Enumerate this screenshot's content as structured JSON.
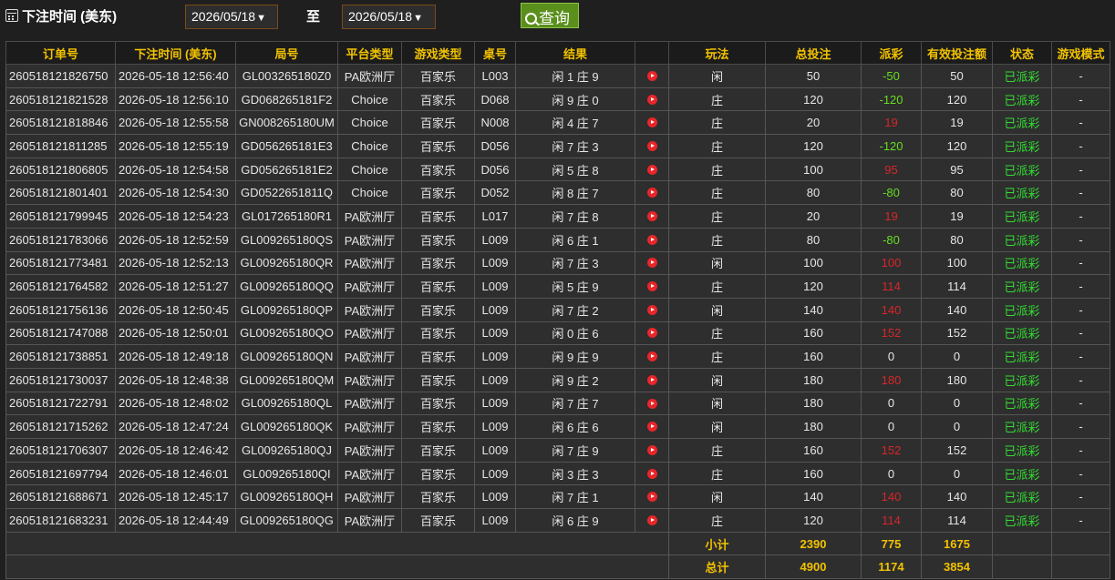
{
  "filter": {
    "label": "下注时间 (美东)",
    "start_date": "2026/05/18",
    "to_label": "至",
    "end_date": "2026/05/18",
    "query_label": "查询",
    "arrow": "▼"
  },
  "table": {
    "headers": [
      "订单号",
      "下注时间 (美东)",
      "局号",
      "平台类型",
      "游戏类型",
      "桌号",
      "结果",
      "",
      "玩法",
      "总投注",
      "派彩",
      "有效投注额",
      "状态",
      "游戏模式"
    ],
    "rows": [
      {
        "order": "260518121826750",
        "time": "2026-05-18 12:56:40",
        "round": "GL003265180Z0",
        "platform": "PA欧洲厅",
        "game": "百家乐",
        "table": "L003",
        "result": "闲 1 庄 9",
        "play": "闲",
        "bet": "50",
        "payout": "-50",
        "payout_type": "neg",
        "valid": "50",
        "status": "已派彩",
        "mode": "-"
      },
      {
        "order": "260518121821528",
        "time": "2026-05-18 12:56:10",
        "round": "GD068265181F2",
        "platform": "Choice",
        "game": "百家乐",
        "table": "D068",
        "result": "闲 9 庄 0",
        "play": "庄",
        "bet": "120",
        "payout": "-120",
        "payout_type": "neg",
        "valid": "120",
        "status": "已派彩",
        "mode": "-"
      },
      {
        "order": "260518121818846",
        "time": "2026-05-18 12:55:58",
        "round": "GN008265180UM",
        "platform": "Choice",
        "game": "百家乐",
        "table": "N008",
        "result": "闲 4 庄 7",
        "play": "庄",
        "bet": "20",
        "payout": "19",
        "payout_type": "pos",
        "valid": "19",
        "status": "已派彩",
        "mode": "-"
      },
      {
        "order": "260518121811285",
        "time": "2026-05-18 12:55:19",
        "round": "GD056265181E3",
        "platform": "Choice",
        "game": "百家乐",
        "table": "D056",
        "result": "闲 7 庄 3",
        "play": "庄",
        "bet": "120",
        "payout": "-120",
        "payout_type": "neg",
        "valid": "120",
        "status": "已派彩",
        "mode": "-"
      },
      {
        "order": "260518121806805",
        "time": "2026-05-18 12:54:58",
        "round": "GD056265181E2",
        "platform": "Choice",
        "game": "百家乐",
        "table": "D056",
        "result": "闲 5 庄 8",
        "play": "庄",
        "bet": "100",
        "payout": "95",
        "payout_type": "pos",
        "valid": "95",
        "status": "已派彩",
        "mode": "-"
      },
      {
        "order": "260518121801401",
        "time": "2026-05-18 12:54:30",
        "round": "GD0522651811Q",
        "platform": "Choice",
        "game": "百家乐",
        "table": "D052",
        "result": "闲 8 庄 7",
        "play": "庄",
        "bet": "80",
        "payout": "-80",
        "payout_type": "neg",
        "valid": "80",
        "status": "已派彩",
        "mode": "-"
      },
      {
        "order": "260518121799945",
        "time": "2026-05-18 12:54:23",
        "round": "GL017265180R1",
        "platform": "PA欧洲厅",
        "game": "百家乐",
        "table": "L017",
        "result": "闲 7 庄 8",
        "play": "庄",
        "bet": "20",
        "payout": "19",
        "payout_type": "pos",
        "valid": "19",
        "status": "已派彩",
        "mode": "-"
      },
      {
        "order": "260518121783066",
        "time": "2026-05-18 12:52:59",
        "round": "GL009265180QS",
        "platform": "PA欧洲厅",
        "game": "百家乐",
        "table": "L009",
        "result": "闲 6 庄 1",
        "play": "庄",
        "bet": "80",
        "payout": "-80",
        "payout_type": "neg",
        "valid": "80",
        "status": "已派彩",
        "mode": "-"
      },
      {
        "order": "260518121773481",
        "time": "2026-05-18 12:52:13",
        "round": "GL009265180QR",
        "platform": "PA欧洲厅",
        "game": "百家乐",
        "table": "L009",
        "result": "闲 7 庄 3",
        "play": "闲",
        "bet": "100",
        "payout": "100",
        "payout_type": "pos",
        "valid": "100",
        "status": "已派彩",
        "mode": "-"
      },
      {
        "order": "260518121764582",
        "time": "2026-05-18 12:51:27",
        "round": "GL009265180QQ",
        "platform": "PA欧洲厅",
        "game": "百家乐",
        "table": "L009",
        "result": "闲 5 庄 9",
        "play": "庄",
        "bet": "120",
        "payout": "114",
        "payout_type": "pos",
        "valid": "114",
        "status": "已派彩",
        "mode": "-"
      },
      {
        "order": "260518121756136",
        "time": "2026-05-18 12:50:45",
        "round": "GL009265180QP",
        "platform": "PA欧洲厅",
        "game": "百家乐",
        "table": "L009",
        "result": "闲 7 庄 2",
        "play": "闲",
        "bet": "140",
        "payout": "140",
        "payout_type": "pos",
        "valid": "140",
        "status": "已派彩",
        "mode": "-"
      },
      {
        "order": "260518121747088",
        "time": "2026-05-18 12:50:01",
        "round": "GL009265180QO",
        "platform": "PA欧洲厅",
        "game": "百家乐",
        "table": "L009",
        "result": "闲 0 庄 6",
        "play": "庄",
        "bet": "160",
        "payout": "152",
        "payout_type": "pos",
        "valid": "152",
        "status": "已派彩",
        "mode": "-"
      },
      {
        "order": "260518121738851",
        "time": "2026-05-18 12:49:18",
        "round": "GL009265180QN",
        "platform": "PA欧洲厅",
        "game": "百家乐",
        "table": "L009",
        "result": "闲 9 庄 9",
        "play": "庄",
        "bet": "160",
        "payout": "0",
        "payout_type": "zero",
        "valid": "0",
        "status": "已派彩",
        "mode": "-"
      },
      {
        "order": "260518121730037",
        "time": "2026-05-18 12:48:38",
        "round": "GL009265180QM",
        "platform": "PA欧洲厅",
        "game": "百家乐",
        "table": "L009",
        "result": "闲 9 庄 2",
        "play": "闲",
        "bet": "180",
        "payout": "180",
        "payout_type": "pos",
        "valid": "180",
        "status": "已派彩",
        "mode": "-"
      },
      {
        "order": "260518121722791",
        "time": "2026-05-18 12:48:02",
        "round": "GL009265180QL",
        "platform": "PA欧洲厅",
        "game": "百家乐",
        "table": "L009",
        "result": "闲 7 庄 7",
        "play": "闲",
        "bet": "180",
        "payout": "0",
        "payout_type": "zero",
        "valid": "0",
        "status": "已派彩",
        "mode": "-"
      },
      {
        "order": "260518121715262",
        "time": "2026-05-18 12:47:24",
        "round": "GL009265180QK",
        "platform": "PA欧洲厅",
        "game": "百家乐",
        "table": "L009",
        "result": "闲 6 庄 6",
        "play": "闲",
        "bet": "180",
        "payout": "0",
        "payout_type": "zero",
        "valid": "0",
        "status": "已派彩",
        "mode": "-"
      },
      {
        "order": "260518121706307",
        "time": "2026-05-18 12:46:42",
        "round": "GL009265180QJ",
        "platform": "PA欧洲厅",
        "game": "百家乐",
        "table": "L009",
        "result": "闲 7 庄 9",
        "play": "庄",
        "bet": "160",
        "payout": "152",
        "payout_type": "pos",
        "valid": "152",
        "status": "已派彩",
        "mode": "-"
      },
      {
        "order": "260518121697794",
        "time": "2026-05-18 12:46:01",
        "round": "GL009265180QI",
        "platform": "PA欧洲厅",
        "game": "百家乐",
        "table": "L009",
        "result": "闲 3 庄 3",
        "play": "庄",
        "bet": "160",
        "payout": "0",
        "payout_type": "zero",
        "valid": "0",
        "status": "已派彩",
        "mode": "-"
      },
      {
        "order": "260518121688671",
        "time": "2026-05-18 12:45:17",
        "round": "GL009265180QH",
        "platform": "PA欧洲厅",
        "game": "百家乐",
        "table": "L009",
        "result": "闲 7 庄 1",
        "play": "闲",
        "bet": "140",
        "payout": "140",
        "payout_type": "pos",
        "valid": "140",
        "status": "已派彩",
        "mode": "-"
      },
      {
        "order": "260518121683231",
        "time": "2026-05-18 12:44:49",
        "round": "GL009265180QG",
        "platform": "PA欧洲厅",
        "game": "百家乐",
        "table": "L009",
        "result": "闲 6 庄 9",
        "play": "庄",
        "bet": "120",
        "payout": "114",
        "payout_type": "pos",
        "valid": "114",
        "status": "已派彩",
        "mode": "-"
      }
    ],
    "subtotal": {
      "label": "小计",
      "bet": "2390",
      "payout": "775",
      "valid": "1675"
    },
    "total": {
      "label": "总计",
      "bet": "4900",
      "payout": "1174",
      "valid": "3854"
    }
  },
  "colors": {
    "header_text": "#f2c200",
    "negative": "#66dd22",
    "positive": "#d8262a",
    "status": "#33dd33",
    "query_button": "#5a8f1c"
  },
  "icons": {
    "filter": "calendar-icon",
    "query": "search-icon",
    "row_action": "play-icon"
  }
}
